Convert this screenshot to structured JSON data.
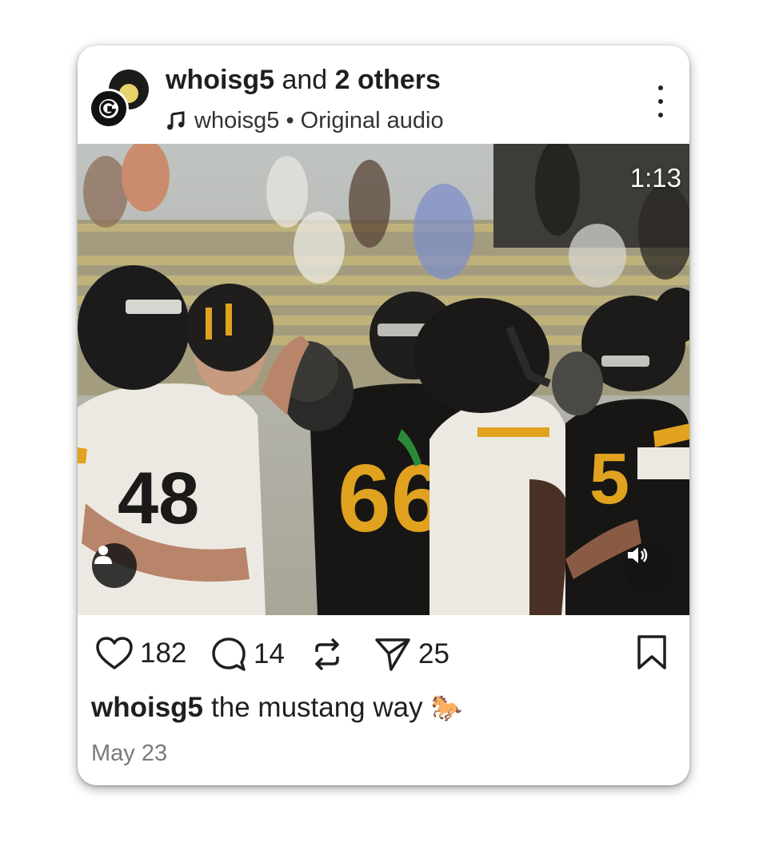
{
  "post": {
    "author": "whoisg5",
    "title_connector": "and",
    "collaborators": "2 others",
    "audio": {
      "icon": "music-note-icon",
      "label": "whoisg5 • Original audio"
    },
    "duration": "1:13",
    "stats": {
      "likes": "182",
      "comments": "14",
      "shares": "25"
    },
    "caption": {
      "author": "whoisg5",
      "text": "the mustang way",
      "emoji": "🐎"
    },
    "date": "May 23"
  },
  "colors": {
    "team_gold": "#e0a21f",
    "jersey_black": "#171614",
    "jersey_white": "#ece9e2"
  }
}
